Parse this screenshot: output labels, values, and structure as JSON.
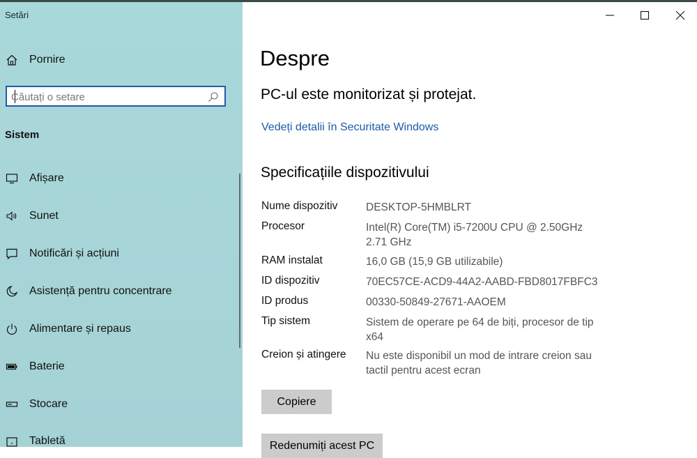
{
  "window": {
    "title": "Setări",
    "controls": [
      "minimize",
      "maximize",
      "close"
    ]
  },
  "sidebar": {
    "home_label": "Pornire",
    "search_placeholder": "Căutați o setare",
    "section_title": "Sistem",
    "items": [
      {
        "label": "Afișare",
        "icon": "display-icon"
      },
      {
        "label": "Sunet",
        "icon": "speaker-icon"
      },
      {
        "label": "Notificări și acțiuni",
        "icon": "notification-icon"
      },
      {
        "label": "Asistență pentru concentrare",
        "icon": "moon-icon"
      },
      {
        "label": "Alimentare și repaus",
        "icon": "power-icon"
      },
      {
        "label": "Baterie",
        "icon": "battery-icon"
      },
      {
        "label": "Stocare",
        "icon": "storage-icon"
      },
      {
        "label": "Tabletă",
        "icon": "tablet-icon"
      }
    ]
  },
  "main": {
    "title": "Despre",
    "protection_status": "PC-ul este monitorizat și protejat.",
    "security_link": "Vedeți detalii în Securitate Windows",
    "specs_title": "Specificațiile dispozitivului",
    "specs": [
      {
        "key": "Nume dispozitiv",
        "value": "DESKTOP-5HMBLRT"
      },
      {
        "key": "Procesor",
        "value": "Intel(R) Core(TM) i5-7200U CPU @ 2.50GHz   2.71 GHz"
      },
      {
        "key": "RAM instalat",
        "value": "16,0 GB (15,9 GB utilizabile)"
      },
      {
        "key": "ID dispozitiv",
        "value": "70EC57CE-ACD9-44A2-AABD-FBD8017FBFC3"
      },
      {
        "key": "ID produs",
        "value": "00330-50849-27671-AAOEM"
      },
      {
        "key": "Tip sistem",
        "value": "Sistem de operare pe 64 de biți, procesor de tip x64"
      },
      {
        "key": "Creion și atingere",
        "value": "Nu este disponibil un mod de intrare creion sau tactil pentru acest ecran"
      }
    ],
    "copy_button": "Copiere",
    "rename_button": "Redenumiți acest PC"
  },
  "colors": {
    "sidebar_bg": "#a8d6d9",
    "link": "#1a5aa8",
    "search_border": "#1f5aa6",
    "button_bg": "#cccccc"
  }
}
